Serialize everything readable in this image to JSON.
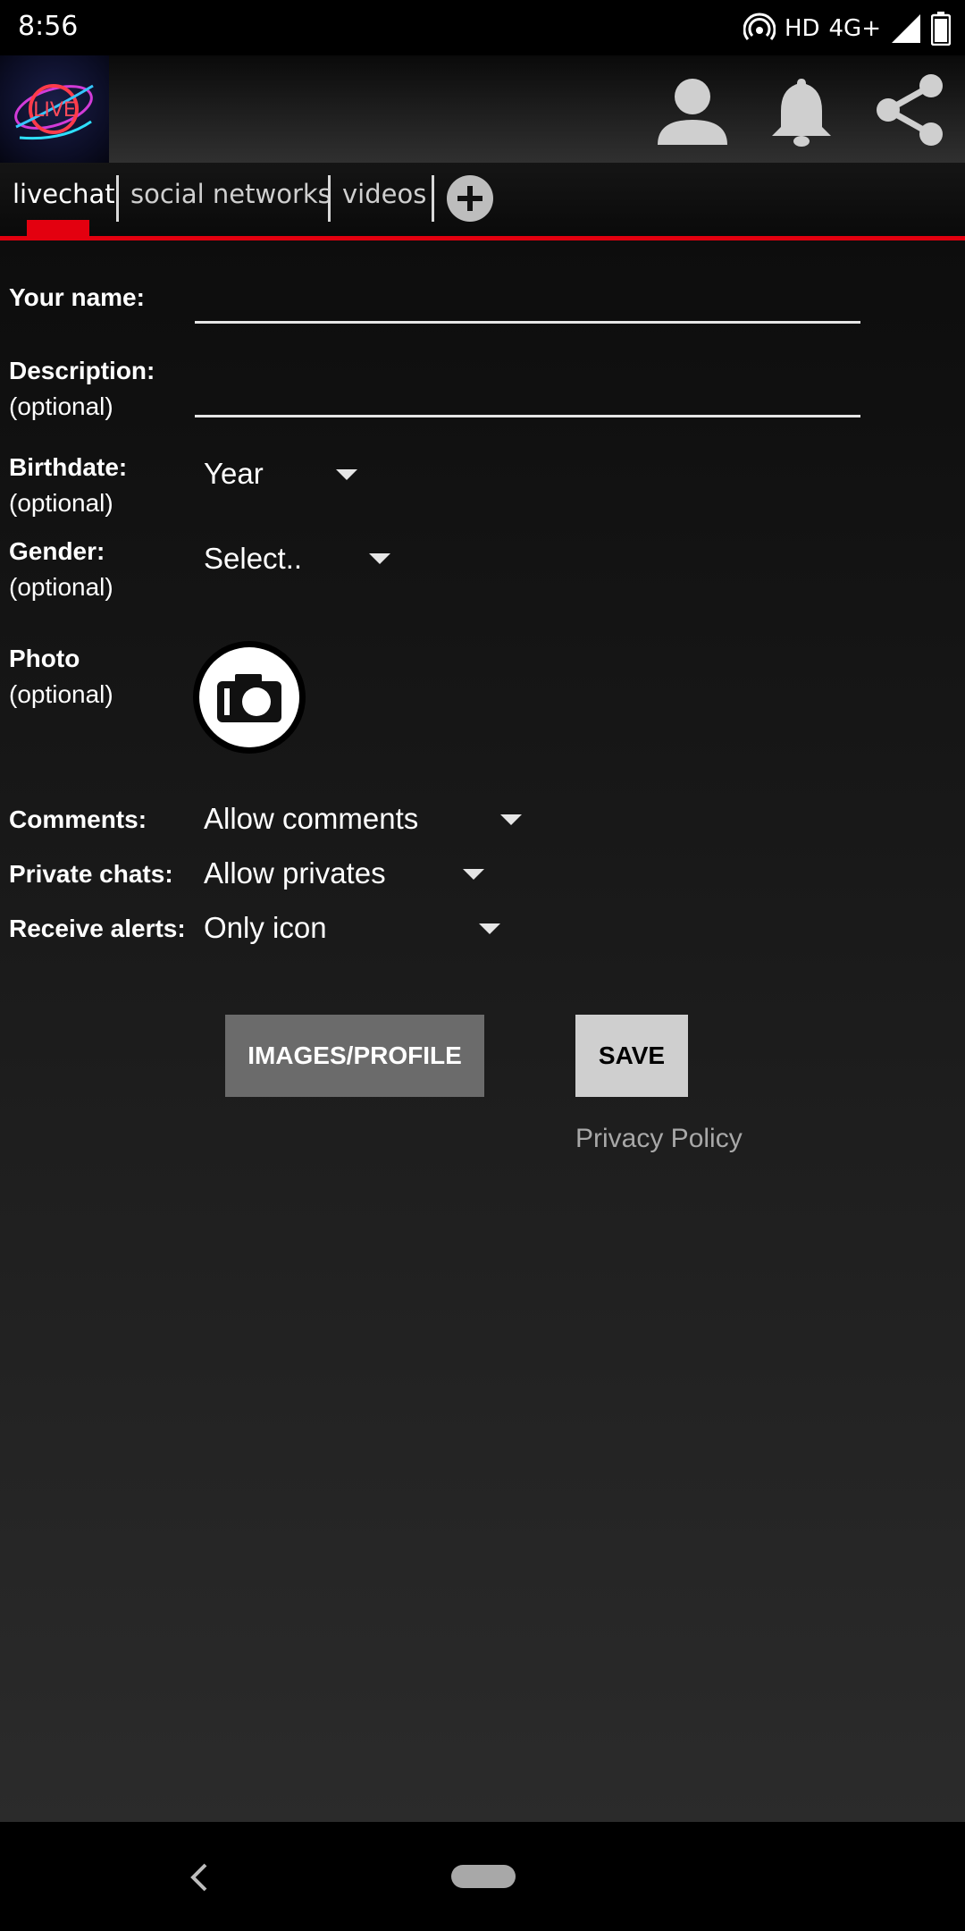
{
  "status": {
    "time": "8:56",
    "hd": "HD",
    "network": "4G+",
    "icons": [
      "hotspot-icon",
      "signal-icon",
      "battery-icon"
    ]
  },
  "app_bar": {
    "logo_text": "LIVE",
    "icons": [
      "profile-icon",
      "bell-icon",
      "share-icon"
    ]
  },
  "tabs": {
    "items": [
      "livechat",
      "social networks",
      "videos"
    ],
    "active": "livechat",
    "add_icon": "plus-circle-icon",
    "accent": "#e3000f"
  },
  "form": {
    "name_label": "Your name:",
    "name_value": "",
    "description_label": "Description:",
    "description_sub": "(optional)",
    "description_value": "",
    "birthdate_label": "Birthdate:",
    "birthdate_sub": "(optional)",
    "birthdate_value": "Year",
    "gender_label": "Gender:",
    "gender_sub": "(optional)",
    "gender_value": "Select..",
    "photo_label": "Photo",
    "photo_sub": "(optional)",
    "photo_icon": "camera-icon",
    "comments_label": "Comments:",
    "comments_value": "Allow comments",
    "private_label": "Private chats:",
    "private_value": "Allow privates",
    "alerts_label": "Receive alerts:",
    "alerts_value": "Only icon"
  },
  "actions": {
    "images_label": "IMAGES/PROFILE",
    "save_label": "SAVE",
    "privacy_label": "Privacy Policy"
  },
  "nav": {
    "icons": [
      "back-icon",
      "home-pill-icon"
    ]
  }
}
